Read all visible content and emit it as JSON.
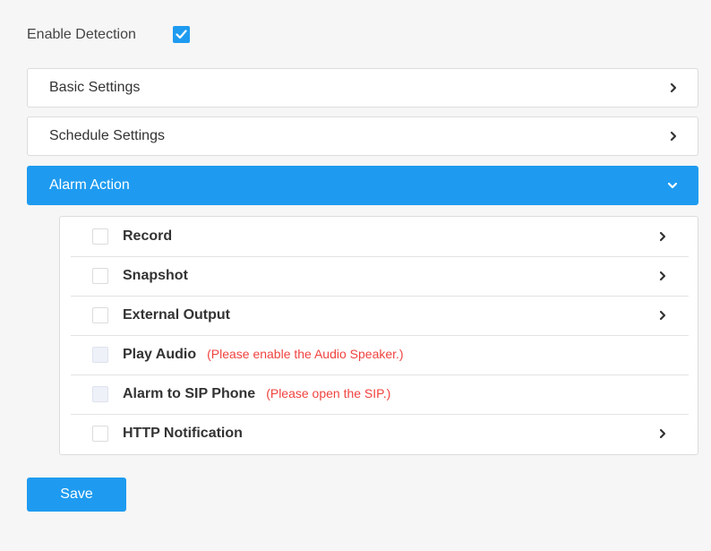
{
  "enable_detection": {
    "label": "Enable Detection",
    "checked": true
  },
  "panels": [
    {
      "label": "Basic Settings",
      "expanded": false,
      "icon": "chevron-right-icon"
    },
    {
      "label": "Schedule Settings",
      "expanded": false,
      "icon": "chevron-right-icon"
    },
    {
      "label": "Alarm Action",
      "expanded": true,
      "icon": "chevron-down-icon"
    }
  ],
  "alarm_actions": [
    {
      "label": "Record",
      "note": "",
      "checked": false,
      "disabled": false,
      "has_chevron": true
    },
    {
      "label": "Snapshot",
      "note": "",
      "checked": false,
      "disabled": false,
      "has_chevron": true
    },
    {
      "label": "External Output",
      "note": "",
      "checked": false,
      "disabled": false,
      "has_chevron": true
    },
    {
      "label": "Play Audio",
      "note": "(Please enable the Audio Speaker.)",
      "checked": false,
      "disabled": true,
      "has_chevron": false
    },
    {
      "label": "Alarm to SIP Phone",
      "note": "(Please open the SIP.)",
      "checked": false,
      "disabled": true,
      "has_chevron": false
    },
    {
      "label": "HTTP Notification",
      "note": "",
      "checked": false,
      "disabled": false,
      "has_chevron": true
    }
  ],
  "save": {
    "label": "Save"
  },
  "colors": {
    "accent": "#1e9bf0",
    "warning": "#f0433f",
    "background": "#f6f6f6"
  }
}
